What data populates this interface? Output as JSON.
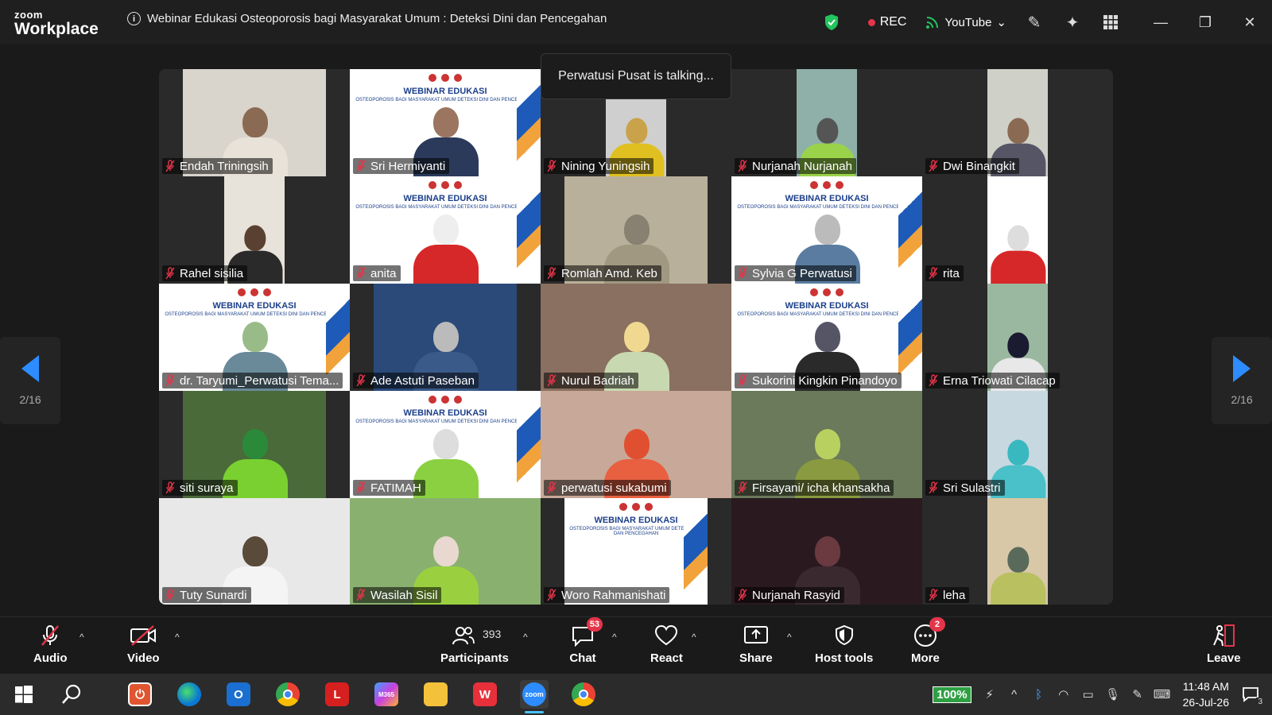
{
  "app": {
    "logo_line1": "zoom",
    "logo_line2": "Workplace",
    "meeting_title": "Webinar Edukasi Osteoporosis bagi Masyarakat Umum : Deteksi Dini dan Pencegahan"
  },
  "titlebar": {
    "rec_label": "REC",
    "stream_label": "YouTube",
    "rec_color": "#e5354a",
    "shield_color": "#22c55e"
  },
  "talking_indicator": "Perwatusi Pusat is talking...",
  "pagination": {
    "left": "2/16",
    "right": "2/16"
  },
  "banner": {
    "title": "WEBINAR EDUKASI",
    "subtitle": "OSTEOPOROSIS BAGI MASYARAKAT UMUM DETEKSI DINI DAN PENCEGAHAN"
  },
  "participants": [
    {
      "name": "Endah Triningsih",
      "kind": "narrow",
      "bg": "#d9d4cc",
      "skin": "#8a6a52",
      "shirt": "#e8e2d8"
    },
    {
      "name": "Sri Hermiyanti",
      "kind": "banner",
      "bg": "#fff",
      "skin": "#9b7560",
      "shirt": "#2b3a5a"
    },
    {
      "name": "Nining Yuningsih",
      "kind": "narrow",
      "bg": "#cfcfcf",
      "skin": "#c9a24a",
      "shirt": "#e0c020"
    },
    {
      "name": "Nurjanah Nurjanah",
      "kind": "narrow",
      "bg": "#8fb0a8",
      "skin": "#555",
      "shirt": "#9ad24a"
    },
    {
      "name": "Dwi Binangkit",
      "kind": "narrow",
      "bg": "#cfd0c8",
      "skin": "#8a6a52",
      "shirt": "#556"
    },
    {
      "name": "Rahel sisilia",
      "kind": "narrow",
      "bg": "#e7e2da",
      "skin": "#5a4030",
      "shirt": "#2a2a2a"
    },
    {
      "name": "anita",
      "kind": "banner",
      "bg": "#fff",
      "skin": "#eee",
      "shirt": "#d62828"
    },
    {
      "name": "Romlah Amd. Keb",
      "kind": "wide",
      "bg": "#b8b09a",
      "skin": "#888070",
      "shirt": "#a09880"
    },
    {
      "name": "Sylvia G Perwatusi",
      "kind": "banner",
      "bg": "#fff",
      "skin": "#bbb",
      "shirt": "#5a7ca0"
    },
    {
      "name": "rita",
      "kind": "narrow",
      "bg": "#fff",
      "skin": "#ddd",
      "shirt": "#d62828"
    },
    {
      "name": "dr. Taryumi_Perwatusi Tema...",
      "kind": "bannerfull",
      "bg": "#fff",
      "skin": "#9b8",
      "shirt": "#6a8a9a"
    },
    {
      "name": "Ade Astuti Paseban",
      "kind": "wide",
      "bg": "#2b4a7a",
      "skin": "#bbb",
      "shirt": "#3a5a8a"
    },
    {
      "name": "Nurul Badriah",
      "kind": "full",
      "bg": "#8a7060",
      "skin": "#f0d890",
      "shirt": "#c8d8b0"
    },
    {
      "name": "Sukorini Kingkin Pinandoyo",
      "kind": "banner",
      "bg": "#fff",
      "skin": "#556",
      "shirt": "#2a2a2a"
    },
    {
      "name": "Erna Triowati Cilacap",
      "kind": "narrow",
      "bg": "#9ab8a0",
      "skin": "#1a1a30",
      "shirt": "#e8e8e8"
    },
    {
      "name": "siti suraya",
      "kind": "narrow",
      "bg": "#4a6a3a",
      "skin": "#2a8a3a",
      "shirt": "#7ad030"
    },
    {
      "name": "FATIMAH",
      "kind": "banner",
      "bg": "#fff",
      "skin": "#ddd",
      "shirt": "#8ad040"
    },
    {
      "name": "perwatusi sukabumi",
      "kind": "full",
      "bg": "#c8a898",
      "skin": "#e05030",
      "shirt": "#e86040"
    },
    {
      "name": "Firsayani/ icha khansakha",
      "kind": "full",
      "bg": "#6a7a5a",
      "skin": "#b8d060",
      "shirt": "#8a9a40"
    },
    {
      "name": "Sri Sulastri",
      "kind": "narrow",
      "bg": "#c8d8e0",
      "skin": "#3ab8c0",
      "shirt": "#4ac0c8"
    },
    {
      "name": "Tuty Sunardi",
      "kind": "full",
      "bg": "#e8e8e8",
      "skin": "#5a4a3a",
      "shirt": "#f4f4f4"
    },
    {
      "name": "Wasilah Sisil",
      "kind": "full",
      "bg": "#8ab070",
      "skin": "#e8d8d0",
      "shirt": "#9ad040"
    },
    {
      "name": "Woro Rahmanishati",
      "kind": "banner",
      "bg": "#fff",
      "skin": "#fff",
      "shirt": "#fff"
    },
    {
      "name": "Nurjanah Rasyid",
      "kind": "full",
      "bg": "#2a1a20",
      "skin": "#6a3a40",
      "shirt": "#3a2a30"
    },
    {
      "name": "leha",
      "kind": "narrow",
      "bg": "#d8c8a8",
      "skin": "#5a6a5a",
      "shirt": "#b8c060"
    }
  ],
  "toolbar": {
    "audio": "Audio",
    "video": "Video",
    "participants": "Participants",
    "participants_count": "393",
    "chat": "Chat",
    "chat_badge": "53",
    "react": "React",
    "share": "Share",
    "host_tools": "Host tools",
    "more": "More",
    "more_badge": "2",
    "leave": "Leave"
  },
  "taskbar": {
    "battery": "100%",
    "time": "11:48 AM",
    "date": "26-Jul-26",
    "notif_count": "3"
  }
}
